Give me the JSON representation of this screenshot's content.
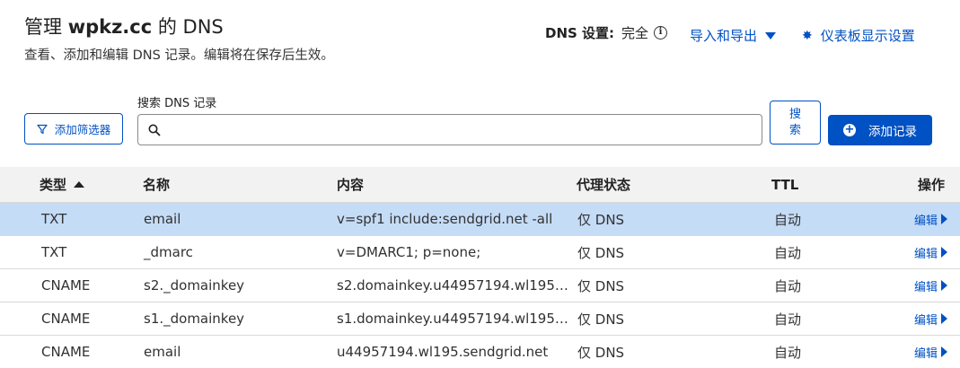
{
  "header": {
    "title_prefix": "管理 ",
    "title_domain": "wpkz.cc",
    "title_suffix": " 的 DNS",
    "subtitle": "查看、添加和编辑 DNS 记录。编辑将在保存后生效。",
    "dns_settings_label": "DNS 设置:",
    "dns_settings_value": "完全",
    "import_export_label": "导入和导出",
    "dashboard_settings_label": "仪表板显示设置"
  },
  "toolbar": {
    "filter_label": "添加筛选器",
    "search_label": "搜索 DNS 记录",
    "search_value": "",
    "search_button_line1": "搜",
    "search_button_line2": "索",
    "add_record_label": "添加记录"
  },
  "table": {
    "columns": [
      "类型",
      "名称",
      "内容",
      "代理状态",
      "TTL",
      "操作"
    ],
    "rows": [
      {
        "type": "TXT",
        "name": "email",
        "content": "v=spf1 include:sendgrid.net -all",
        "proxy": "仅 DNS",
        "ttl": "自动",
        "action": "编辑"
      },
      {
        "type": "TXT",
        "name": "_dmarc",
        "content": "v=DMARC1; p=none;",
        "proxy": "仅 DNS",
        "ttl": "自动",
        "action": "编辑"
      },
      {
        "type": "CNAME",
        "name": "s2._domainkey",
        "content": "s2.domainkey.u44957194.wl195....",
        "proxy": "仅 DNS",
        "ttl": "自动",
        "action": "编辑"
      },
      {
        "type": "CNAME",
        "name": "s1._domainkey",
        "content": "s1.domainkey.u44957194.wl195....",
        "proxy": "仅 DNS",
        "ttl": "自动",
        "action": "编辑"
      },
      {
        "type": "CNAME",
        "name": "email",
        "content": "u44957194.wl195.sendgrid.net",
        "proxy": "仅 DNS",
        "ttl": "自动",
        "action": "编辑"
      }
    ]
  },
  "colors": {
    "accent": "#0051c3",
    "selected_row": "#c5dcf7",
    "header_bg": "#f2f2f2"
  },
  "icons": {
    "info": "info-icon",
    "caret": "caret-down-icon",
    "gear": "gear-icon",
    "filter": "filter-icon",
    "search": "search-icon",
    "add": "plus-circle-icon",
    "sort": "sort-asc-icon",
    "edit_arrow": "chevron-right-icon"
  }
}
